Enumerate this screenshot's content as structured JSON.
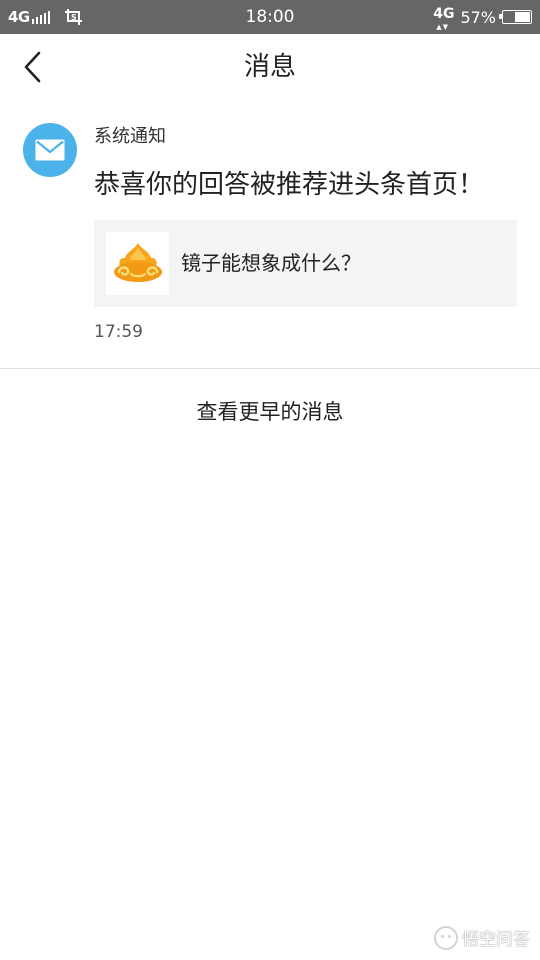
{
  "status_bar": {
    "network_left": "4G",
    "time": "18:00",
    "network_right": "4G",
    "battery_percent": "57%",
    "battery_level": 0.57,
    "icons": [
      "signal-icon",
      "screenshot-icon",
      "data-arrows-icon",
      "battery-icon"
    ]
  },
  "nav": {
    "title": "消息",
    "back_icon": "chevron-left-icon"
  },
  "message": {
    "sender": "系统通知",
    "text": "恭喜你的回答被推荐进头条首页！",
    "card_title": "镜子能想象成什么？",
    "time": "17:59",
    "avatar_icon": "mail-icon",
    "avatar_color": "#4cb3ea"
  },
  "load_earlier": {
    "label": "查看更早的消息"
  },
  "watermark": {
    "text": "悟空问答"
  },
  "colors": {
    "status_bar_bg": "#666666",
    "card_bg": "#f3f4f6",
    "divider": "#e2e2e2",
    "thumb_gold": "#f3a51f"
  }
}
